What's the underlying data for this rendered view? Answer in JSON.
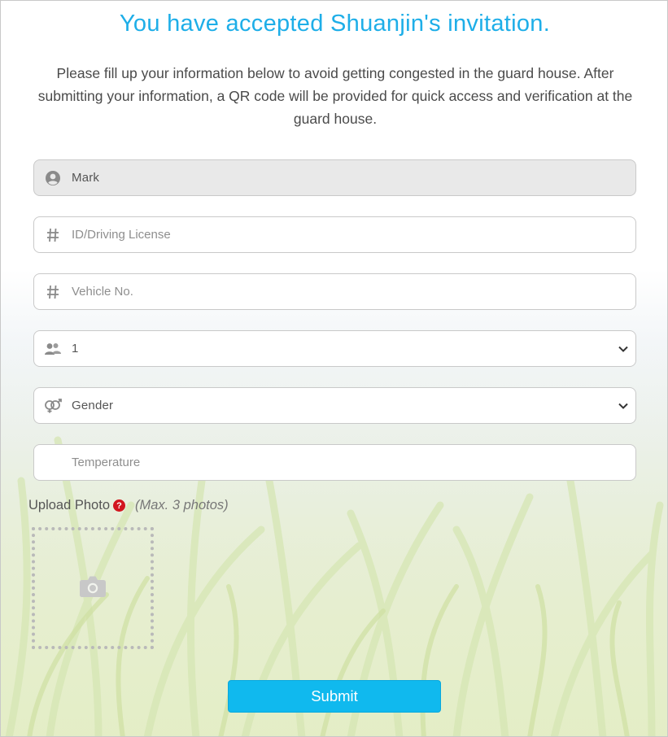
{
  "header": {
    "title": "You have accepted Shuanjin's invitation.",
    "intro": "Please fill up your information below to avoid getting congested in the guard house. After submitting your information, a QR code will be provided for quick access and verification at the guard house."
  },
  "form": {
    "name": {
      "value": "Mark",
      "icon": "user-circle-icon"
    },
    "id_license": {
      "placeholder": "ID/Driving License",
      "icon": "hash-icon"
    },
    "vehicle": {
      "placeholder": "Vehicle No.",
      "icon": "hash-icon"
    },
    "visitors": {
      "value": "1",
      "icon": "users-icon"
    },
    "gender": {
      "value": "Gender",
      "icon": "gender-icon"
    },
    "temperature": {
      "placeholder": "Temperature"
    }
  },
  "upload": {
    "label": "Upload Photo",
    "help_glyph": "?",
    "note": "(Max. 3 photos)",
    "icon": "camera-icon"
  },
  "submit_label": "Submit",
  "colors": {
    "title": "#1eaee8",
    "submit_bg": "#10b9ee",
    "help_icon": "#d2151e"
  }
}
